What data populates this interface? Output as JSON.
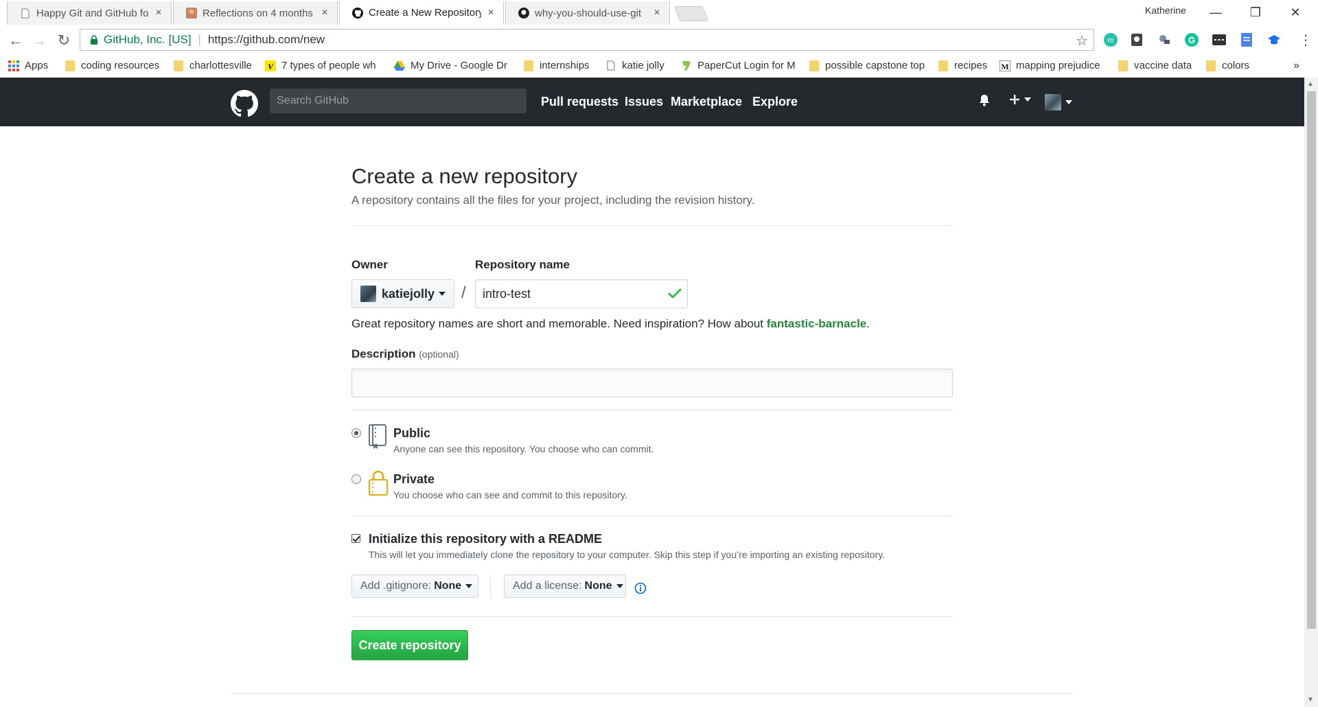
{
  "browser": {
    "tabs": [
      {
        "title": "Happy Git and GitHub fo",
        "active": false
      },
      {
        "title": "Reflections on 4 months",
        "active": false
      },
      {
        "title": "Create a New Repository",
        "active": true
      },
      {
        "title": "why-you-should-use-git",
        "active": false
      }
    ],
    "profile_name": "Katherine",
    "window": {
      "minimize": "—",
      "restore": "❐",
      "close": "✕"
    },
    "omnibox": {
      "org": "GitHub, Inc. [US]",
      "url": "https://github.com/new"
    },
    "bookmarks": [
      {
        "label": "Apps",
        "icon": "apps-grid-icon"
      },
      {
        "label": "coding resources",
        "icon": "folder-icon"
      },
      {
        "label": "charlottesville",
        "icon": "folder-icon"
      },
      {
        "label": "7 types of people wh",
        "icon": "v-logo-icon"
      },
      {
        "label": "My Drive - Google Dr",
        "icon": "drive-icon"
      },
      {
        "label": "internships",
        "icon": "folder-icon"
      },
      {
        "label": "katie jolly",
        "icon": "page-icon"
      },
      {
        "label": "PaperCut Login for M",
        "icon": "papercut-icon"
      },
      {
        "label": "possible capstone top",
        "icon": "folder-icon"
      },
      {
        "label": "recipes",
        "icon": "folder-icon"
      },
      {
        "label": "mapping prejudice",
        "icon": "m-logo-icon"
      },
      {
        "label": "vaccine data",
        "icon": "folder-icon"
      },
      {
        "label": "colors",
        "icon": "folder-icon"
      }
    ],
    "more_bookmarks": "»"
  },
  "github_header": {
    "search_placeholder": "Search GitHub",
    "nav": [
      "Pull requests",
      "Issues",
      "Marketplace",
      "Explore"
    ]
  },
  "form": {
    "title": "Create a new repository",
    "subtitle": "A repository contains all the files for your project, including the revision history.",
    "owner_label": "Owner",
    "owner_value": "katiejolly",
    "slash": "/",
    "repo_label": "Repository name",
    "repo_value": "intro-test",
    "hint_prefix": "Great repository names are short and memorable. Need inspiration? How about ",
    "hint_suggestion": "fantastic-barnacle",
    "hint_suffix": ".",
    "description_label": "Description",
    "description_optional": "(optional)",
    "description_value": "",
    "visibility": [
      {
        "title": "Public",
        "note": "Anyone can see this repository. You choose who can commit.",
        "selected": true,
        "icon": "repo-book-icon"
      },
      {
        "title": "Private",
        "note": "You choose who can see and commit to this repository.",
        "selected": false,
        "icon": "lock-icon"
      }
    ],
    "readme_title": "Initialize this repository with a README",
    "readme_note": "This will let you immediately clone the repository to your computer. Skip this step if you’re importing an existing repository.",
    "readme_checked": true,
    "gitignore_label": "Add .gitignore:",
    "gitignore_value": "None",
    "license_label": "Add a license:",
    "license_value": "None",
    "submit_label": "Create repository"
  },
  "colors": {
    "header_bg": "#24292e",
    "primary_green": "#28a745",
    "suggestion_green": "#22863a",
    "ok_green": "#2cbe4e"
  }
}
